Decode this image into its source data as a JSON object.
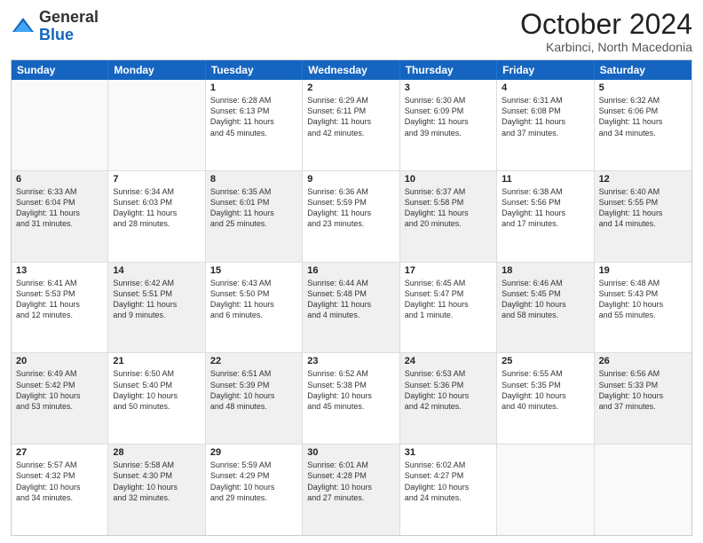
{
  "header": {
    "logo_general": "General",
    "logo_blue": "Blue",
    "month_title": "October 2024",
    "subtitle": "Karbinci, North Macedonia"
  },
  "days_of_week": [
    "Sunday",
    "Monday",
    "Tuesday",
    "Wednesday",
    "Thursday",
    "Friday",
    "Saturday"
  ],
  "rows": [
    [
      {
        "day": "",
        "lines": [],
        "empty": true
      },
      {
        "day": "",
        "lines": [],
        "empty": true
      },
      {
        "day": "1",
        "lines": [
          "Sunrise: 6:28 AM",
          "Sunset: 6:13 PM",
          "Daylight: 11 hours",
          "and 45 minutes."
        ]
      },
      {
        "day": "2",
        "lines": [
          "Sunrise: 6:29 AM",
          "Sunset: 6:11 PM",
          "Daylight: 11 hours",
          "and 42 minutes."
        ]
      },
      {
        "day": "3",
        "lines": [
          "Sunrise: 6:30 AM",
          "Sunset: 6:09 PM",
          "Daylight: 11 hours",
          "and 39 minutes."
        ]
      },
      {
        "day": "4",
        "lines": [
          "Sunrise: 6:31 AM",
          "Sunset: 6:08 PM",
          "Daylight: 11 hours",
          "and 37 minutes."
        ]
      },
      {
        "day": "5",
        "lines": [
          "Sunrise: 6:32 AM",
          "Sunset: 6:06 PM",
          "Daylight: 11 hours",
          "and 34 minutes."
        ]
      }
    ],
    [
      {
        "day": "6",
        "lines": [
          "Sunrise: 6:33 AM",
          "Sunset: 6:04 PM",
          "Daylight: 11 hours",
          "and 31 minutes."
        ],
        "shaded": true
      },
      {
        "day": "7",
        "lines": [
          "Sunrise: 6:34 AM",
          "Sunset: 6:03 PM",
          "Daylight: 11 hours",
          "and 28 minutes."
        ]
      },
      {
        "day": "8",
        "lines": [
          "Sunrise: 6:35 AM",
          "Sunset: 6:01 PM",
          "Daylight: 11 hours",
          "and 25 minutes."
        ],
        "shaded": true
      },
      {
        "day": "9",
        "lines": [
          "Sunrise: 6:36 AM",
          "Sunset: 5:59 PM",
          "Daylight: 11 hours",
          "and 23 minutes."
        ]
      },
      {
        "day": "10",
        "lines": [
          "Sunrise: 6:37 AM",
          "Sunset: 5:58 PM",
          "Daylight: 11 hours",
          "and 20 minutes."
        ],
        "shaded": true
      },
      {
        "day": "11",
        "lines": [
          "Sunrise: 6:38 AM",
          "Sunset: 5:56 PM",
          "Daylight: 11 hours",
          "and 17 minutes."
        ]
      },
      {
        "day": "12",
        "lines": [
          "Sunrise: 6:40 AM",
          "Sunset: 5:55 PM",
          "Daylight: 11 hours",
          "and 14 minutes."
        ],
        "shaded": true
      }
    ],
    [
      {
        "day": "13",
        "lines": [
          "Sunrise: 6:41 AM",
          "Sunset: 5:53 PM",
          "Daylight: 11 hours",
          "and 12 minutes."
        ]
      },
      {
        "day": "14",
        "lines": [
          "Sunrise: 6:42 AM",
          "Sunset: 5:51 PM",
          "Daylight: 11 hours",
          "and 9 minutes."
        ],
        "shaded": true
      },
      {
        "day": "15",
        "lines": [
          "Sunrise: 6:43 AM",
          "Sunset: 5:50 PM",
          "Daylight: 11 hours",
          "and 6 minutes."
        ]
      },
      {
        "day": "16",
        "lines": [
          "Sunrise: 6:44 AM",
          "Sunset: 5:48 PM",
          "Daylight: 11 hours",
          "and 4 minutes."
        ],
        "shaded": true
      },
      {
        "day": "17",
        "lines": [
          "Sunrise: 6:45 AM",
          "Sunset: 5:47 PM",
          "Daylight: 11 hours",
          "and 1 minute."
        ]
      },
      {
        "day": "18",
        "lines": [
          "Sunrise: 6:46 AM",
          "Sunset: 5:45 PM",
          "Daylight: 10 hours",
          "and 58 minutes."
        ],
        "shaded": true
      },
      {
        "day": "19",
        "lines": [
          "Sunrise: 6:48 AM",
          "Sunset: 5:43 PM",
          "Daylight: 10 hours",
          "and 55 minutes."
        ]
      }
    ],
    [
      {
        "day": "20",
        "lines": [
          "Sunrise: 6:49 AM",
          "Sunset: 5:42 PM",
          "Daylight: 10 hours",
          "and 53 minutes."
        ],
        "shaded": true
      },
      {
        "day": "21",
        "lines": [
          "Sunrise: 6:50 AM",
          "Sunset: 5:40 PM",
          "Daylight: 10 hours",
          "and 50 minutes."
        ]
      },
      {
        "day": "22",
        "lines": [
          "Sunrise: 6:51 AM",
          "Sunset: 5:39 PM",
          "Daylight: 10 hours",
          "and 48 minutes."
        ],
        "shaded": true
      },
      {
        "day": "23",
        "lines": [
          "Sunrise: 6:52 AM",
          "Sunset: 5:38 PM",
          "Daylight: 10 hours",
          "and 45 minutes."
        ]
      },
      {
        "day": "24",
        "lines": [
          "Sunrise: 6:53 AM",
          "Sunset: 5:36 PM",
          "Daylight: 10 hours",
          "and 42 minutes."
        ],
        "shaded": true
      },
      {
        "day": "25",
        "lines": [
          "Sunrise: 6:55 AM",
          "Sunset: 5:35 PM",
          "Daylight: 10 hours",
          "and 40 minutes."
        ]
      },
      {
        "day": "26",
        "lines": [
          "Sunrise: 6:56 AM",
          "Sunset: 5:33 PM",
          "Daylight: 10 hours",
          "and 37 minutes."
        ],
        "shaded": true
      }
    ],
    [
      {
        "day": "27",
        "lines": [
          "Sunrise: 5:57 AM",
          "Sunset: 4:32 PM",
          "Daylight: 10 hours",
          "and 34 minutes."
        ]
      },
      {
        "day": "28",
        "lines": [
          "Sunrise: 5:58 AM",
          "Sunset: 4:30 PM",
          "Daylight: 10 hours",
          "and 32 minutes."
        ],
        "shaded": true
      },
      {
        "day": "29",
        "lines": [
          "Sunrise: 5:59 AM",
          "Sunset: 4:29 PM",
          "Daylight: 10 hours",
          "and 29 minutes."
        ]
      },
      {
        "day": "30",
        "lines": [
          "Sunrise: 6:01 AM",
          "Sunset: 4:28 PM",
          "Daylight: 10 hours",
          "and 27 minutes."
        ],
        "shaded": true
      },
      {
        "day": "31",
        "lines": [
          "Sunrise: 6:02 AM",
          "Sunset: 4:27 PM",
          "Daylight: 10 hours",
          "and 24 minutes."
        ]
      },
      {
        "day": "",
        "lines": [],
        "empty": true
      },
      {
        "day": "",
        "lines": [],
        "empty": true
      }
    ]
  ]
}
